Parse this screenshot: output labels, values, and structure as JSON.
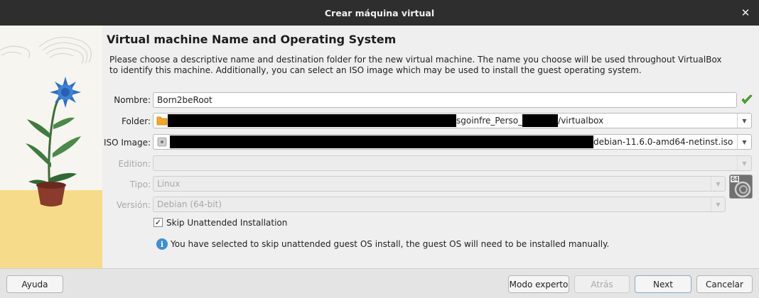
{
  "window": {
    "title": "Crear máquina virtual"
  },
  "header": {
    "heading": "Virtual machine Name and Operating System",
    "description": "Please choose a descriptive name and destination folder for the new virtual machine. The name you choose will be used throughout VirtualBox to identify this machine. Additionally, you can select an ISO image which may be used to install the guest operating system."
  },
  "form": {
    "name_label": "Nombre:",
    "name_value": "Born2beRoot",
    "folder_label": "Folder:",
    "folder_value_mid": "sgoinfre_Perso_",
    "folder_value_end": "/virtualbox",
    "iso_label": "ISO Image:",
    "iso_value_end": "debian-11.6.0-amd64-netinst.iso",
    "edition_label": "Edition:",
    "edition_value": "",
    "tipo_label": "Tipo:",
    "tipo_value": "Linux",
    "version_label": "Versión:",
    "version_value": "Debian (64-bit)",
    "skip_unattended_label": "Skip Unattended Installation",
    "skip_unattended_checked": true,
    "info_text": "You have selected to skip unattended guest OS install, the guest OS will need to be installed manually.",
    "os_badge": "64"
  },
  "footer": {
    "help_label": "Ayuda",
    "expert_label": "Modo experto",
    "back_label": "Atrás",
    "next_label": "Next",
    "cancel_label": "Cancelar"
  },
  "colors": {
    "title_bg": "#2e2e2e",
    "valid_check": "#4caf28",
    "info_blue": "#3b8fd6",
    "folder_orange": "#f5a623"
  }
}
